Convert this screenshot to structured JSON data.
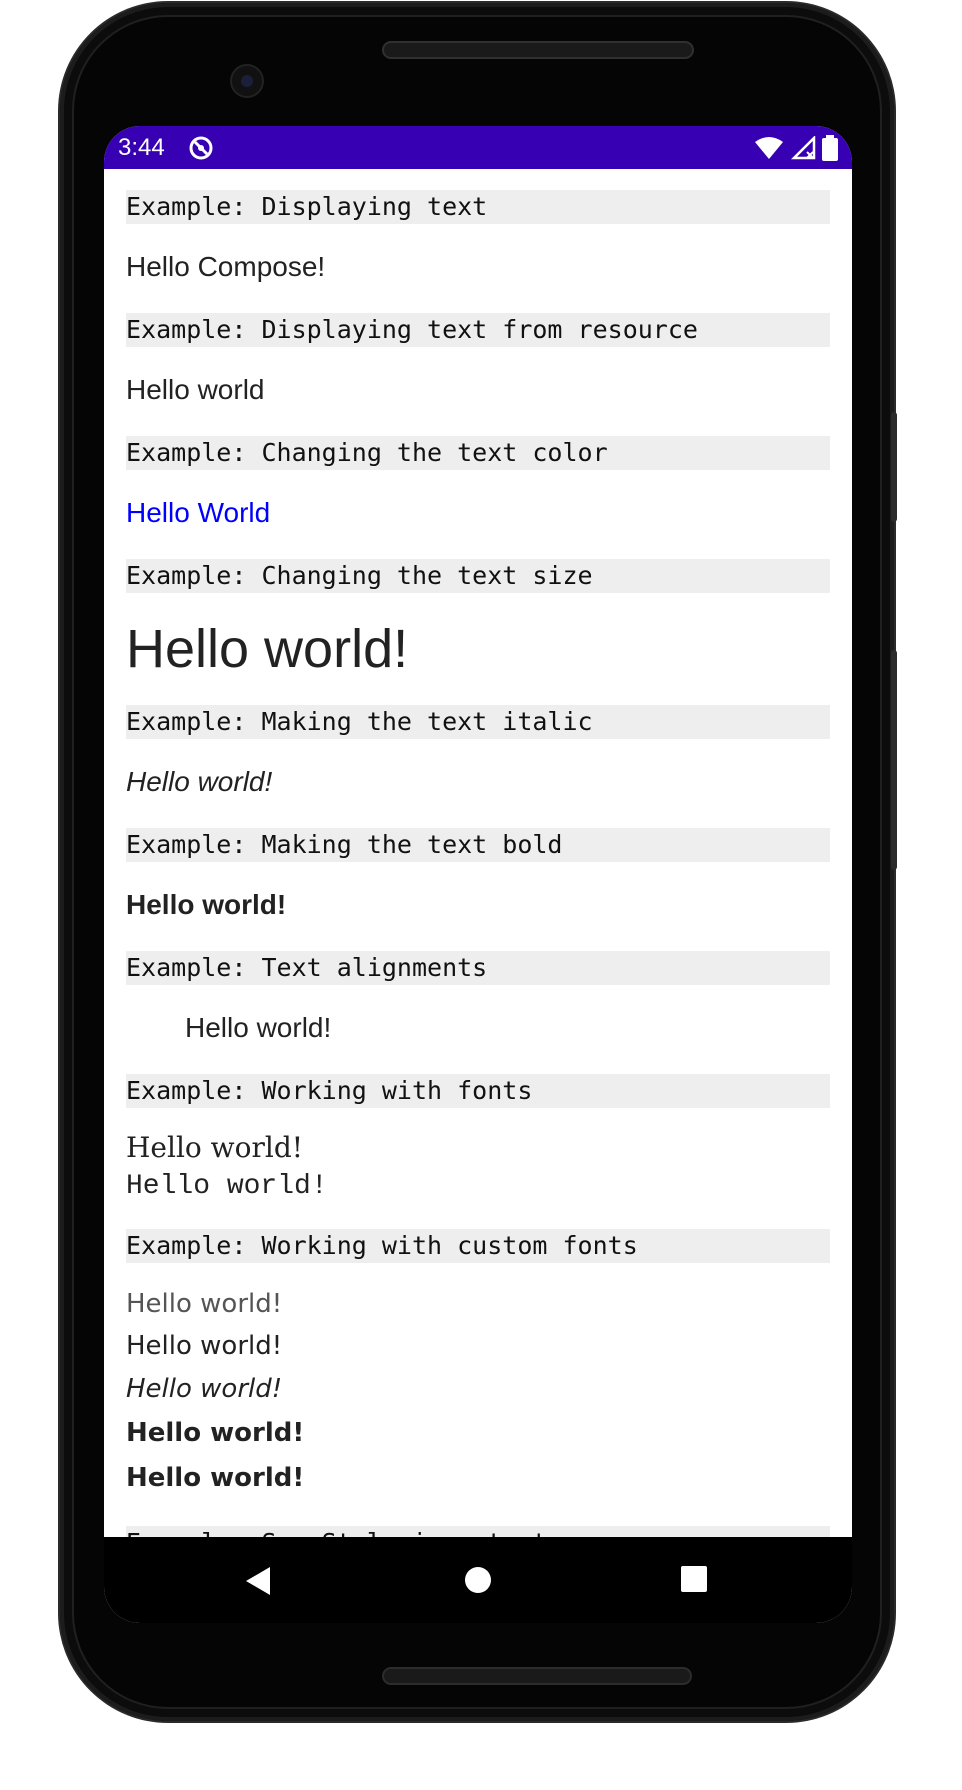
{
  "status_bar": {
    "time": "3:44",
    "sync_icon": "sync-icon",
    "wifi_icon": "wifi-icon",
    "signal_icon": "signal-icon",
    "battery_icon": "battery-icon",
    "background_color": "#3700b3"
  },
  "examples": [
    {
      "header": "Example: Displaying text",
      "samples": [
        "Hello Compose!"
      ]
    },
    {
      "header": "Example: Displaying text from resource",
      "samples": [
        "Hello world"
      ]
    },
    {
      "header": "Example: Changing the text color",
      "samples": [
        "Hello World"
      ],
      "sample_color": "#0000ff"
    },
    {
      "header": "Example: Changing the text size",
      "samples": [
        "Hello world!"
      ]
    },
    {
      "header": "Example: Making the text italic",
      "samples": [
        "Hello world!"
      ]
    },
    {
      "header": "Example: Making the text bold",
      "samples": [
        "Hello world!"
      ]
    },
    {
      "header": "Example: Text alignments",
      "samples": [
        "Hello world!"
      ]
    },
    {
      "header": "Example: Working with fonts",
      "samples": [
        "Hello world!",
        "Hello world!"
      ]
    },
    {
      "header": "Example: Working with custom fonts",
      "samples": [
        "Hello world!",
        "Hello world!",
        "Hello world!",
        "Hello world!",
        "Hello world!"
      ]
    },
    {
      "header": "Example: SpanStyle in a text",
      "samples": []
    }
  ],
  "navigation_bar": {
    "back_icon": "back-triangle-icon",
    "home_icon": "home-circle-icon",
    "recents_icon": "recents-square-icon"
  }
}
